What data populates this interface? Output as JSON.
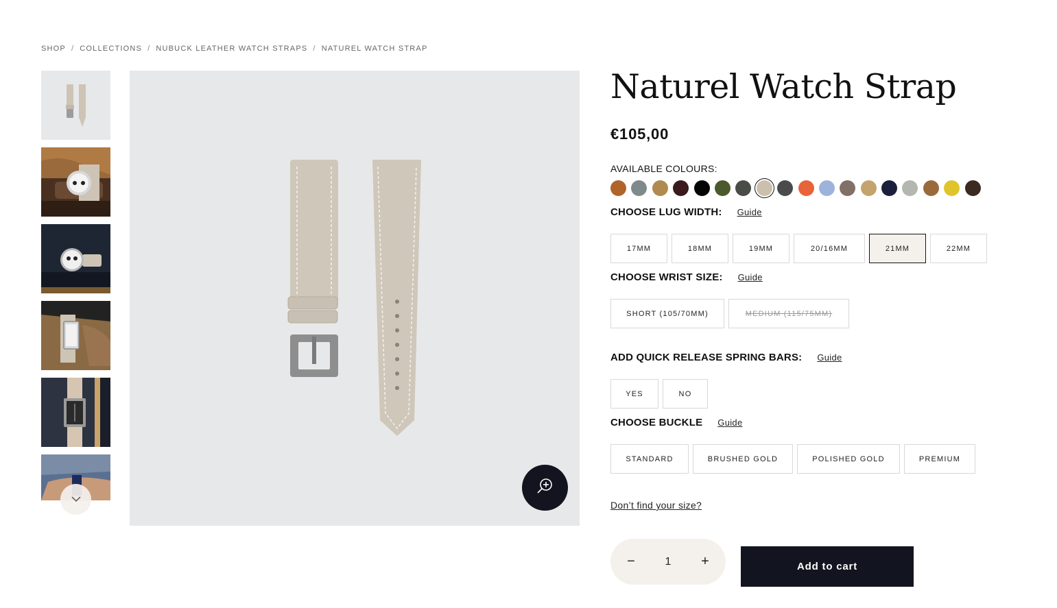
{
  "breadcrumb": {
    "items": [
      "SHOP",
      "COLLECTIONS",
      "NUBUCK LEATHER WATCH STRAPS",
      "NATUREL WATCH STRAP"
    ],
    "separator": "/"
  },
  "product": {
    "title": "Naturel Watch Strap",
    "price": "€105,00"
  },
  "colours": {
    "label": "AVAILABLE COLOURS:",
    "swatches": [
      "#b0642a",
      "#7f8a8c",
      "#b08a4e",
      "#3a1a1c",
      "#050505",
      "#4b5a2c",
      "#4a4c48",
      "#cbbfae",
      "#4a4b4c",
      "#e8633a",
      "#9db3db",
      "#807068",
      "#c4a46c",
      "#1a1f3c",
      "#b3b7b0",
      "#9a6a3c",
      "#dfc42c",
      "#3a2a20"
    ],
    "selected_index": 7
  },
  "lug_width": {
    "label": "CHOOSE LUG WIDTH:",
    "guide": "Guide",
    "options": [
      "17MM",
      "18MM",
      "19MM",
      "20/16MM",
      "21MM",
      "22MM"
    ],
    "selected": "21MM"
  },
  "wrist_size": {
    "label": "CHOOSE WRIST SIZE:",
    "guide": "Guide",
    "options": [
      "SHORT (105/70MM)",
      "MEDIUM (115/75MM)"
    ],
    "disabled": "MEDIUM (115/75MM)"
  },
  "spring_bars": {
    "label": "ADD QUICK RELEASE SPRING BARS:",
    "guide": "Guide",
    "options": [
      "YES",
      "NO"
    ]
  },
  "buckle": {
    "label": "CHOOSE BUCKLE",
    "guide": "Guide",
    "options": [
      "STANDARD",
      "BRUSHED GOLD",
      "POLISHED GOLD",
      "PREMIUM"
    ]
  },
  "size_help": "Don’t find your size?",
  "cart": {
    "minus": "−",
    "quantity": "1",
    "plus": "+",
    "add_label": "Add to cart"
  },
  "icons": {
    "zoom": "zoom-in-icon",
    "thumbs_down": "chevron-down-icon"
  }
}
